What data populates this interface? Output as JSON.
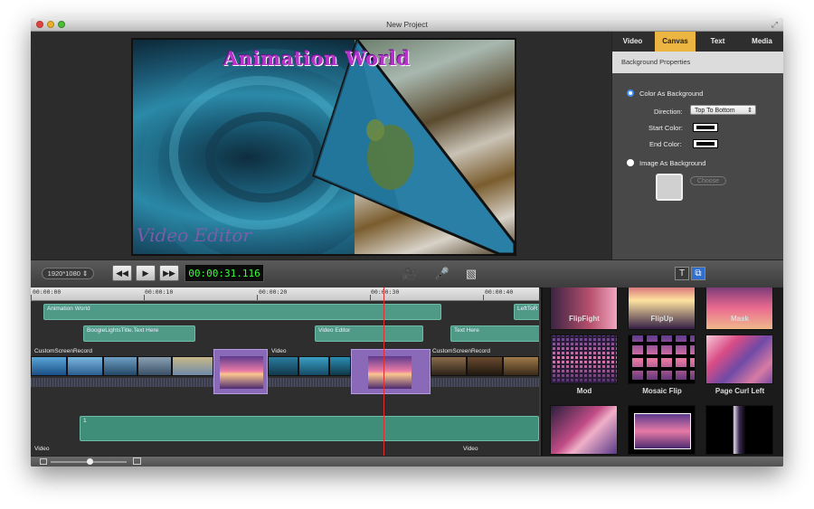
{
  "window": {
    "title": "New Project"
  },
  "preview": {
    "title_text": "Animation World",
    "watermark_text": "Video Editor"
  },
  "props": {
    "tabs": [
      {
        "label": "Video"
      },
      {
        "label": "Canvas",
        "active": true
      },
      {
        "label": "Text"
      },
      {
        "label": "Media"
      }
    ],
    "section_title": "Background Properties",
    "color_bg_label": "Color As Background",
    "direction_label": "Direction:",
    "direction_value": "Top To Bottom",
    "start_color_label": "Start Color:",
    "end_color_label": "End Color:",
    "image_bg_label": "Image As Background",
    "choose_label": "Choose",
    "accent_color": "#ecb441"
  },
  "controls": {
    "resolution": "1920*1080",
    "rewind_icon": "rewind-icon",
    "play_icon": "play-icon",
    "forward_icon": "fast-forward-icon",
    "timecode": "00:00:31.116"
  },
  "timeline": {
    "ruler_labels": [
      "00:00:00",
      "00:00:10",
      "00:00:20",
      "00:00:30",
      "00:00:40"
    ],
    "text_clips": [
      {
        "label": "Animation World"
      },
      {
        "label": "LeftToR"
      },
      {
        "label": "BoogieLightsTitle.Text Here"
      },
      {
        "label": "Video Editor"
      },
      {
        "label": "Text Here"
      }
    ],
    "video_clips": [
      {
        "label": "CustomScreenRecord"
      },
      {
        "label": "Video"
      },
      {
        "label": "CustomScreenRecord"
      }
    ],
    "audio_label": "1",
    "video2_clips": [
      {
        "label": "Video"
      },
      {
        "label": "Video"
      }
    ]
  },
  "library": {
    "items": [
      {
        "label": "FlipFight"
      },
      {
        "label": "FlipUp"
      },
      {
        "label": "Mask"
      },
      {
        "label": "Mod"
      },
      {
        "label": "Mosaic Flip"
      },
      {
        "label": "Page Curl Left"
      },
      {
        "label": ""
      },
      {
        "label": ""
      },
      {
        "label": ""
      }
    ]
  }
}
